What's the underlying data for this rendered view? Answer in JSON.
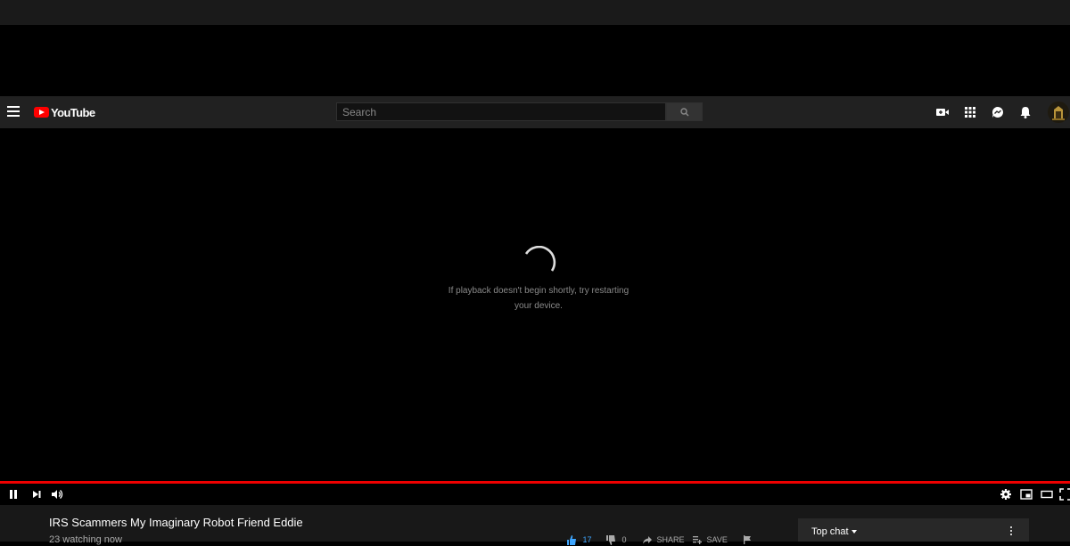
{
  "masthead": {
    "logo_text": "YouTube",
    "search_placeholder": "Search",
    "icons": [
      "menu-icon",
      "search-icon",
      "create-video-icon",
      "apps-grid-icon",
      "messages-icon",
      "notifications-bell-icon",
      "avatar"
    ]
  },
  "player": {
    "message": "If playback doesn't begin shortly, try restarting your device.",
    "progress_color": "#ee0000",
    "controls_left": [
      "pause-icon",
      "next-icon",
      "volume-icon"
    ],
    "controls_right": [
      "settings-icon",
      "miniplayer-icon",
      "theater-mode-icon",
      "fullscreen-icon"
    ]
  },
  "video": {
    "title": "IRS Scammers My Imaginary Robot Friend Eddie",
    "watching": "23 watching now",
    "likes": "17",
    "dislikes": "0",
    "share_label": "SHARE",
    "save_label": "SAVE"
  },
  "chat": {
    "title": "Top chat"
  },
  "colors": {
    "accent": "#ff0000",
    "masthead_bg": "#212121",
    "like_blue": "#3ea6ff"
  }
}
